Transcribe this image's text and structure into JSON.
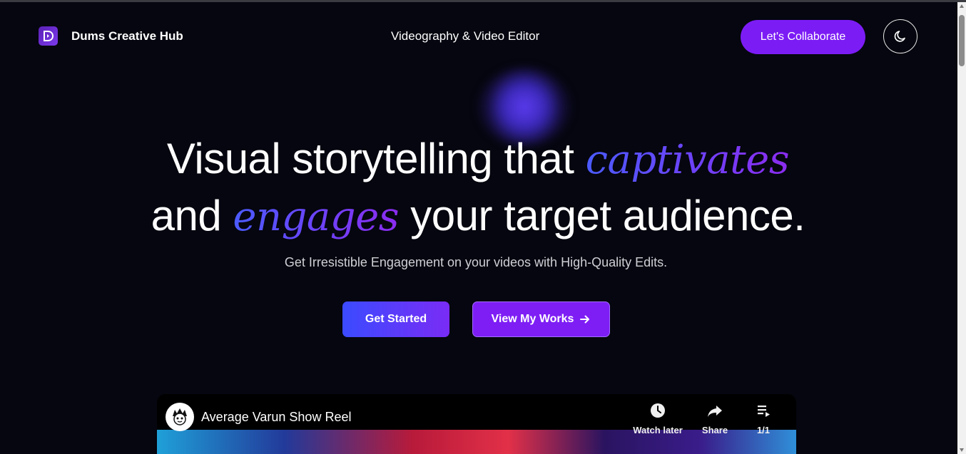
{
  "header": {
    "brand": "Dums Creative Hub",
    "subtitle": "Videography & Video Editor",
    "cta_label": "Let's Collaborate",
    "theme_icon": "moon-icon"
  },
  "hero": {
    "line1_start": "Visual storytelling that ",
    "line1_accent": "captivates",
    "line2_start": "and ",
    "line2_accent": "engages",
    "line2_end": " your target audience.",
    "tagline": "Get Irresistible Engagement on your videos with High-Quality Edits.",
    "primary_button": "Get Started",
    "secondary_button": "View My Works"
  },
  "video": {
    "title": "Average Varun Show Reel",
    "controls": [
      {
        "label": "Watch later",
        "icon": "clock-icon"
      },
      {
        "label": "Share",
        "icon": "share-icon"
      },
      {
        "label": "1/1",
        "icon": "playlist-icon"
      }
    ]
  },
  "colors": {
    "background": "#05060f",
    "accent_purple": "#7c1cf5",
    "accent_blue": "#3b4bff"
  }
}
